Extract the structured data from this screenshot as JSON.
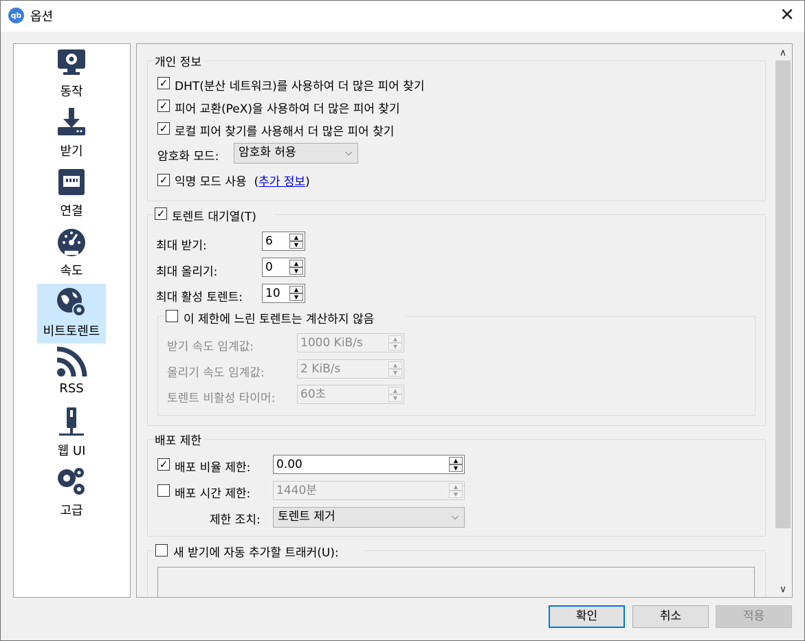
{
  "window": {
    "title": "옵션",
    "app_icon": "qb"
  },
  "sidebar": {
    "items": [
      {
        "label": "동작",
        "icon": "monitor-gear-icon"
      },
      {
        "label": "받기",
        "icon": "download-icon"
      },
      {
        "label": "연결",
        "icon": "network-port-icon"
      },
      {
        "label": "속도",
        "icon": "speedometer-icon"
      },
      {
        "label": "비트토렌트",
        "icon": "globe-gear-icon",
        "selected": true
      },
      {
        "label": "RSS",
        "icon": "rss-icon"
      },
      {
        "label": "웹 UI",
        "icon": "web-ui-icon"
      },
      {
        "label": "고급",
        "icon": "gears-icon"
      }
    ],
    "selected_color": "#cce8ff",
    "icon_color": "#2c3e5c"
  },
  "privacy": {
    "title": "개인 정보",
    "dht_label": "DHT(분산 네트워크)를 사용하여 더 많은 피어 찾기",
    "dht_checked": true,
    "pex_label": "피어 교환(PeX)을 사용하여 더 많은 피어 찾기",
    "pex_checked": true,
    "lsd_label": "로컬 피어 찾기를 사용해서 더 많은 피어 찾기",
    "lsd_checked": true,
    "encryption_label": "암호화 모드:",
    "encryption_value": "암호화 허용",
    "anon_label": "익명 모드 사용",
    "anon_checked": true,
    "more_info_open": "(",
    "more_info_link": "추가 정보",
    "more_info_close": ")"
  },
  "queue": {
    "title": "토렌트 대기열(T)",
    "checked": true,
    "max_downloads_label": "최대 받기:",
    "max_downloads_value": "6",
    "max_uploads_label": "최대 올리기:",
    "max_uploads_value": "0",
    "max_active_label": "최대 활성 토렌트:",
    "max_active_value": "10",
    "slow_group_label": "이 제한에 느린 토렌트는 계산하지 않음",
    "slow_checked": false,
    "dl_threshold_label": "받기 속도 임계값:",
    "dl_threshold_value": "1000 KiB/s",
    "ul_threshold_label": "올리기 속도 임계값:",
    "ul_threshold_value": "2 KiB/s",
    "inactivity_label": "토렌트 비활성 타이머:",
    "inactivity_value": "60초"
  },
  "seeding": {
    "title": "배포 제한",
    "ratio_label": "배포 비율 제한:",
    "ratio_checked": true,
    "ratio_value": "0.00",
    "time_label": "배포 시간 제한:",
    "time_checked": false,
    "time_value": "1440분",
    "action_label": "제한 조치:",
    "action_value": "토렌트 제거"
  },
  "trackers": {
    "label": "새 받기에 자동 추가할 트래커(U):",
    "checked": false
  },
  "buttons": {
    "ok": "확인",
    "cancel": "취소",
    "apply": "적용"
  },
  "scroll": {
    "up": "∧",
    "down": "∨"
  },
  "glyphs": {
    "check": "✓",
    "dropdown": "⌵",
    "close": "✕",
    "spin_up": "▲",
    "spin_down": "▼"
  }
}
